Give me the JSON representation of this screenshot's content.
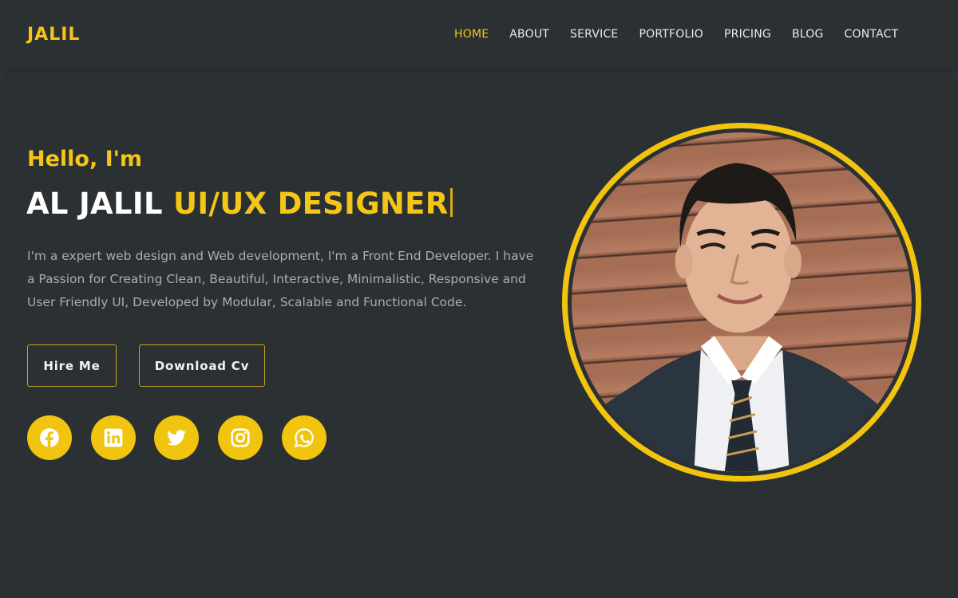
{
  "header": {
    "logo": "JALIL",
    "nav": [
      {
        "label": "HOME",
        "active": true
      },
      {
        "label": "ABOUT",
        "active": false
      },
      {
        "label": "SERVICE",
        "active": false
      },
      {
        "label": "PORTFOLIO",
        "active": false
      },
      {
        "label": "PRICING",
        "active": false
      },
      {
        "label": "BLOG",
        "active": false
      },
      {
        "label": "CONTACT",
        "active": false
      }
    ]
  },
  "hero": {
    "greeting": "Hello, I'm",
    "name": "AL JALIL",
    "role": "UI/UX DESIGNER",
    "bio": "I'm a expert web design and Web development, I'm a Front End Developer. I have a Passion for Creating Clean, Beautiful, Interactive, Minimalistic, Responsive and User Friendly UI, Developed by Modular, Scalable and Functional Code.",
    "buttons": {
      "hire": "Hire Me",
      "download": "Download Cv"
    },
    "social": [
      {
        "icon": "facebook-icon",
        "label": "Facebook"
      },
      {
        "icon": "linkedin-icon",
        "label": "LinkedIn"
      },
      {
        "icon": "twitter-icon",
        "label": "Twitter"
      },
      {
        "icon": "instagram-icon",
        "label": "Instagram"
      },
      {
        "icon": "whatsapp-icon",
        "label": "WhatsApp"
      }
    ],
    "portrait_alt": "Portrait of a smiling man in a dark suit and striped tie in front of a wooden wall"
  },
  "colors": {
    "accent": "#f1c40f",
    "background": "#2b3033",
    "text": "#ffffff",
    "muted_text": "#a9adb0"
  }
}
